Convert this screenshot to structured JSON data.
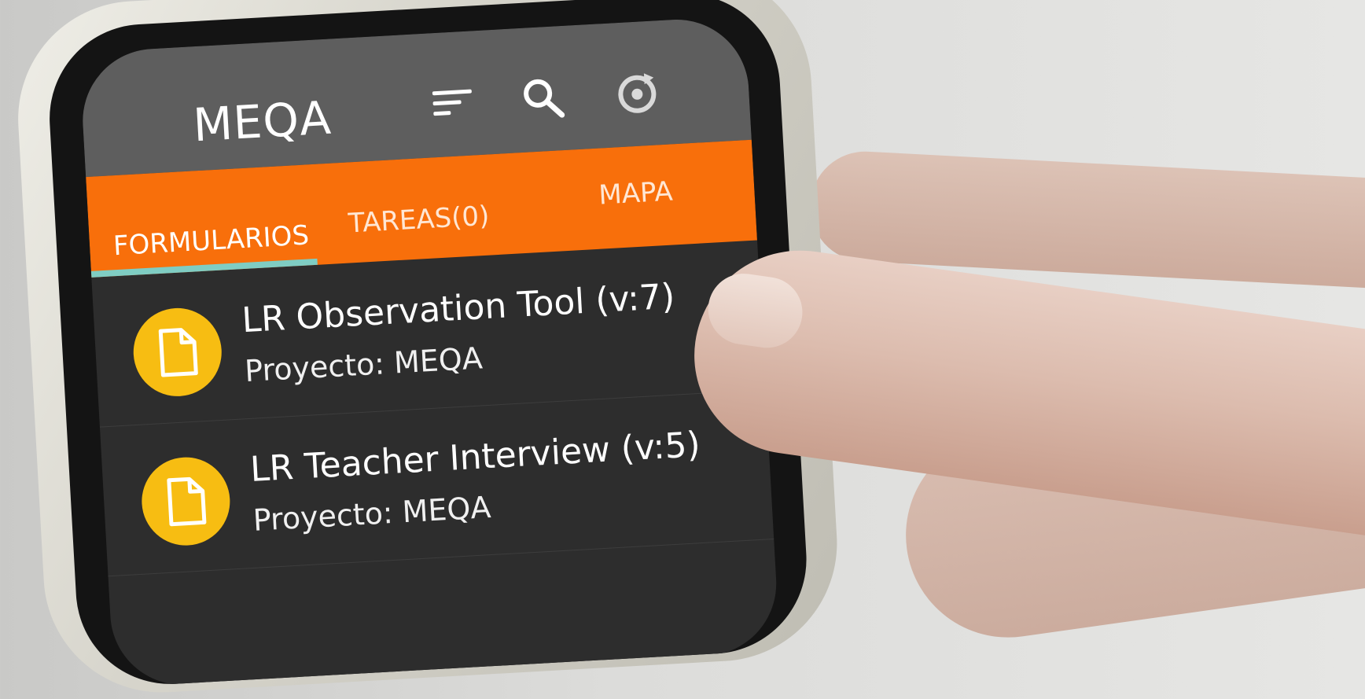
{
  "app_bar": {
    "title": "MEQA",
    "icons": [
      "sort-icon",
      "search-icon",
      "refresh-icon"
    ]
  },
  "tabs": [
    {
      "label": "FORMULARIOS",
      "active": true
    },
    {
      "label": "TAREAS(0)",
      "active": false
    },
    {
      "label": "MAPA",
      "active": false
    }
  ],
  "forms": [
    {
      "title": "LR Observation Tool (v:7)",
      "subtitle": "Proyecto: MEQA",
      "icon": "document-icon"
    },
    {
      "title": "LR Teacher Interview (v:5)",
      "subtitle": "Proyecto: MEQA",
      "icon": "document-icon"
    }
  ],
  "colors": {
    "app_bar": "#5e5e5e",
    "tab_bar": "#f86f0b",
    "tab_indicator": "#7fcdc3",
    "list_background": "#2d2d2d",
    "form_icon": "#f7bd12"
  }
}
